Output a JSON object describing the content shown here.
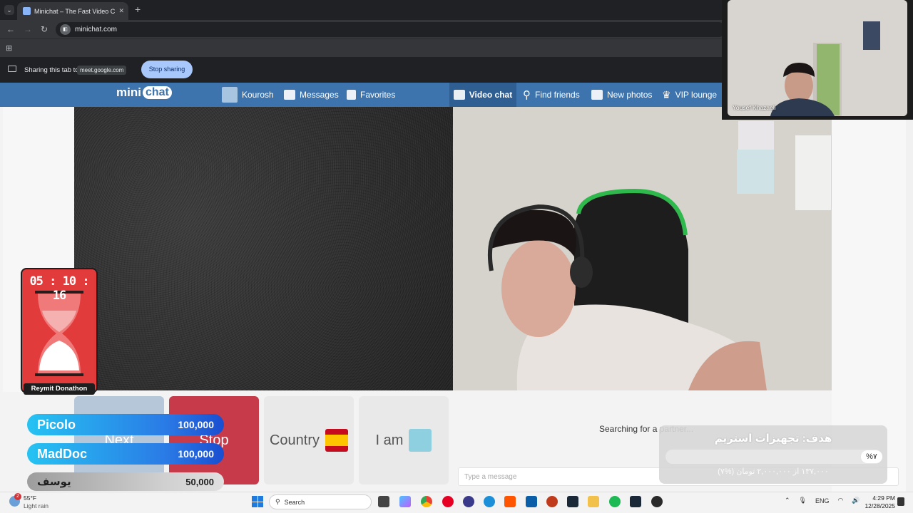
{
  "browser": {
    "tab_title": "Minichat – The Fast Video C",
    "url": "minichat.com",
    "sharing_text": "Sharing this tab to",
    "sharing_target": "meet.google.com",
    "stop_sharing": "Stop sharing"
  },
  "site": {
    "logo_left": "mini",
    "logo_right": "chat",
    "nav": {
      "user": "Kourosh",
      "messages": "Messages",
      "favorites": "Favorites",
      "video_chat": "Video chat",
      "find_friends": "Find friends",
      "new_photos": "New photos",
      "vip_lounge": "VIP lounge"
    },
    "controls": {
      "next": "Next",
      "stop": "Stop",
      "country": "Country",
      "i_am": "I am"
    },
    "searching": "Searching for a partner...",
    "message_placeholder": "Type a message"
  },
  "overlays": {
    "timer": "05 : 10 : 16",
    "timer_label": "Reymit Donathon",
    "donors": [
      {
        "name": "Picolo",
        "amount": "100,000"
      },
      {
        "name": "MadDoc",
        "amount": "100,000"
      },
      {
        "name": "یوسف",
        "amount": "50,000"
      }
    ],
    "goal": {
      "title": "هدف: تجهیزات استریم",
      "percent_label": "%۷",
      "subtitle": "۱۳۷,۰۰۰ از ۲,۰۰۰,۰۰۰ تومان (%۷)",
      "progress": 0.07
    }
  },
  "meet": {
    "participant": "Yousef Khazaeli"
  },
  "taskbar": {
    "weather_badge": "2",
    "temperature": "55°F",
    "condition": "Light rain",
    "search": "Search",
    "language": "ENG",
    "time": "4:29 PM",
    "date": "12/28/2025"
  },
  "colors": {
    "nav_blue": "#3d74ad",
    "stop_red": "#c73a4a",
    "next_blue": "#b7c7da",
    "timer_red": "#e23b3b"
  }
}
